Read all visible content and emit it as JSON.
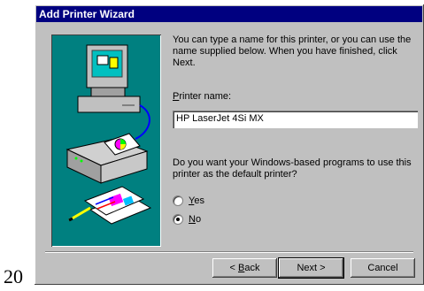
{
  "page_number": "20",
  "window": {
    "title": "Add Printer Wizard"
  },
  "wizard": {
    "intro_text": "You can type a name for this printer, or you can use the name supplied below. When you have finished, click Next.",
    "printer_name_label_first": "P",
    "printer_name_label_rest": "rinter name:",
    "printer_name_value": "HP LaserJet 4Si MX",
    "default_question": "Do you want your Windows-based programs to use this printer as the default printer?",
    "options": [
      {
        "mnemonic": "Y",
        "rest": "es",
        "selected": false
      },
      {
        "mnemonic": "N",
        "rest": "o",
        "selected": true
      }
    ]
  },
  "buttons": {
    "back_prefix": "< ",
    "back_mnemonic": "B",
    "back_rest": "ack",
    "next": "Next >",
    "cancel": "Cancel"
  },
  "colors": {
    "titlebar": "#000080",
    "art_background": "#008080",
    "dialog_face": "#c0c0c0"
  },
  "icons": [
    "computer-monitor-icon",
    "printer-icon",
    "printed-pages-icon"
  ]
}
